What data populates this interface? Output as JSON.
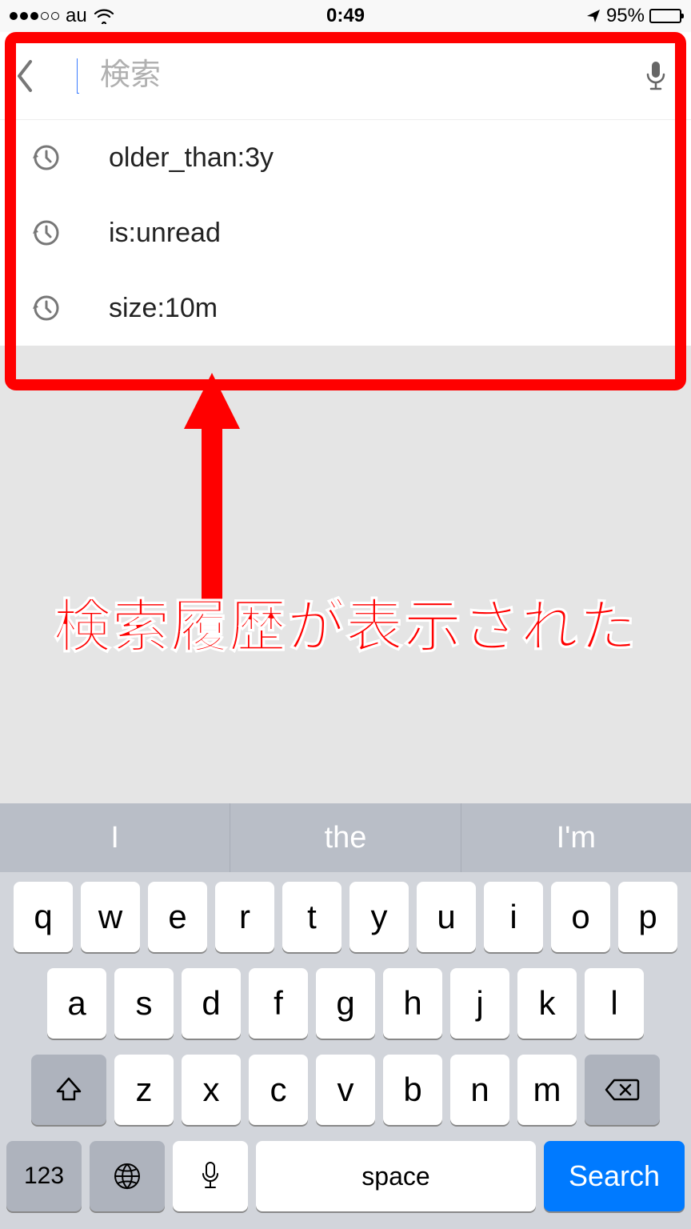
{
  "status": {
    "carrier": "au",
    "time": "0:49",
    "battery_pct": "95%"
  },
  "search": {
    "placeholder": "検索"
  },
  "history": [
    {
      "query": "older_than:3y"
    },
    {
      "query": "is:unread"
    },
    {
      "query": "size:10m"
    }
  ],
  "annotation": {
    "caption": "検索履歴が表示された"
  },
  "keyboard": {
    "suggestions": [
      "I",
      "the",
      "I'm"
    ],
    "row1": [
      "q",
      "w",
      "e",
      "r",
      "t",
      "y",
      "u",
      "i",
      "o",
      "p"
    ],
    "row2": [
      "a",
      "s",
      "d",
      "f",
      "g",
      "h",
      "j",
      "k",
      "l"
    ],
    "row3": [
      "z",
      "x",
      "c",
      "v",
      "b",
      "n",
      "m"
    ],
    "numbers_label": "123",
    "space_label": "space",
    "search_label": "Search"
  }
}
